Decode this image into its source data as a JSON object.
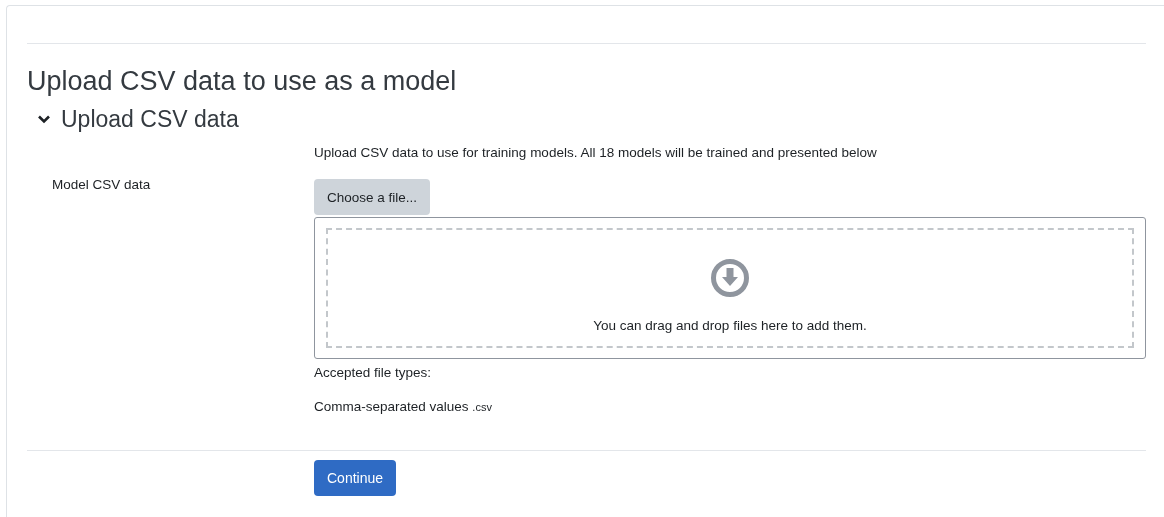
{
  "heading": "Upload CSV data to use as a model",
  "section": {
    "title": "Upload CSV data",
    "expanded": true
  },
  "description": "Upload CSV data to use for training models. All 18 models will be trained and presented below",
  "field": {
    "label": "Model CSV data",
    "button": "Choose a file...",
    "dropzone_text": "You can drag and drop files here to add them."
  },
  "accepted_label": "Accepted file types:",
  "file_types": [
    {
      "name": "Comma-separated values",
      "extension": ".csv"
    }
  ],
  "submit_button": "Continue"
}
